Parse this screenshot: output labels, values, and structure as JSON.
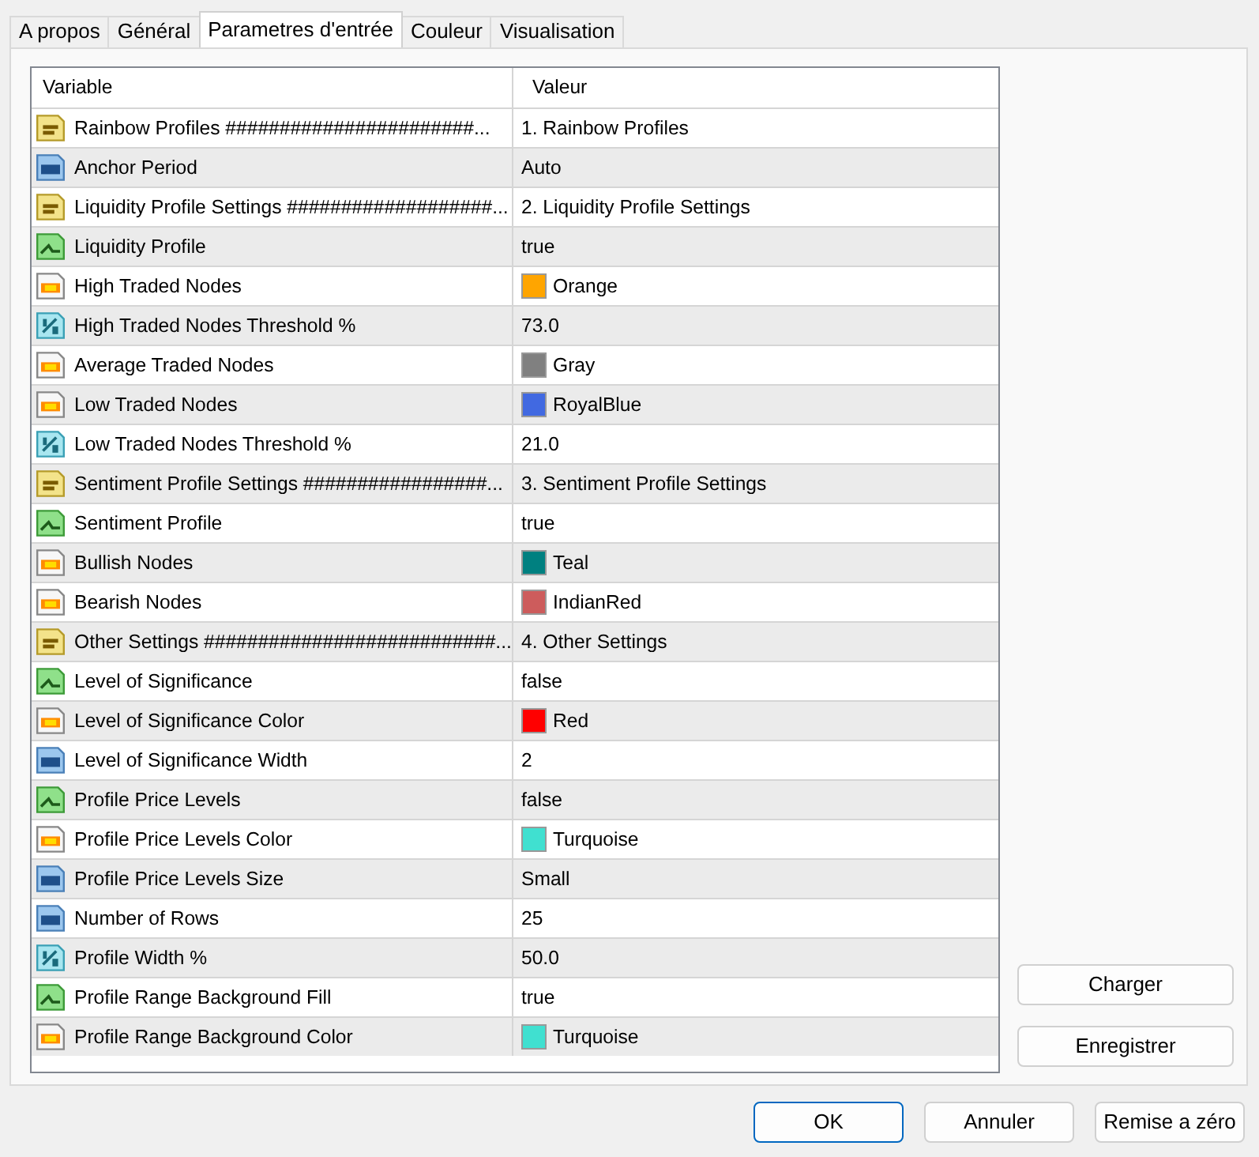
{
  "tabs": [
    {
      "label": "A propos",
      "selected": false
    },
    {
      "label": "Général",
      "selected": false
    },
    {
      "label": "Parametres d'entrée",
      "selected": true
    },
    {
      "label": "Couleur",
      "selected": false
    },
    {
      "label": "Visualisation",
      "selected": false
    }
  ],
  "table": {
    "columns": [
      "Variable",
      "Valeur"
    ],
    "rows": [
      {
        "kind": "string",
        "variable": "Rainbow Profiles #######################...",
        "value": "1. Rainbow Profiles"
      },
      {
        "kind": "int",
        "variable": "Anchor Period",
        "value": "Auto"
      },
      {
        "kind": "string",
        "variable": "Liquidity Profile Settings ###################...",
        "value": "2. Liquidity Profile Settings"
      },
      {
        "kind": "bool",
        "variable": "Liquidity Profile",
        "value": "true"
      },
      {
        "kind": "color",
        "variable": "High Traded Nodes",
        "value": "Orange",
        "color": "#ffa500"
      },
      {
        "kind": "double",
        "variable": "High Traded Nodes Threshold %",
        "value": "73.0"
      },
      {
        "kind": "color",
        "variable": "Average Traded Nodes",
        "value": "Gray",
        "color": "#808080"
      },
      {
        "kind": "color",
        "variable": "Low Traded Nodes",
        "value": "RoyalBlue",
        "color": "#4169e1"
      },
      {
        "kind": "double",
        "variable": "Low Traded Nodes Threshold %",
        "value": "21.0"
      },
      {
        "kind": "string",
        "variable": "Sentiment Profile Settings #################...",
        "value": "3. Sentiment Profile Settings"
      },
      {
        "kind": "bool",
        "variable": "Sentiment Profile",
        "value": "true"
      },
      {
        "kind": "color",
        "variable": "Bullish Nodes",
        "value": "Teal",
        "color": "#008080"
      },
      {
        "kind": "color",
        "variable": "Bearish Nodes",
        "value": "IndianRed",
        "color": "#cd5c5c"
      },
      {
        "kind": "string",
        "variable": "Other Settings ###########################...",
        "value": "4. Other Settings"
      },
      {
        "kind": "bool",
        "variable": "Level of Significance",
        "value": "false"
      },
      {
        "kind": "color",
        "variable": "Level of Significance Color",
        "value": "Red",
        "color": "#ff0000"
      },
      {
        "kind": "int",
        "variable": "Level of Significance Width",
        "value": "2"
      },
      {
        "kind": "bool",
        "variable": "Profile Price Levels",
        "value": "false"
      },
      {
        "kind": "color",
        "variable": "Profile Price Levels Color",
        "value": "Turquoise",
        "color": "#40e0d0"
      },
      {
        "kind": "int",
        "variable": "Profile Price Levels Size",
        "value": "Small"
      },
      {
        "kind": "int",
        "variable": "Number of Rows",
        "value": "25"
      },
      {
        "kind": "double",
        "variable": "Profile Width %",
        "value": "50.0"
      },
      {
        "kind": "bool",
        "variable": "Profile Range Background Fill",
        "value": "true"
      },
      {
        "kind": "color",
        "variable": "Profile Range Background Color",
        "value": "Turquoise",
        "color": "#40e0d0"
      }
    ]
  },
  "side_buttons": [
    "Charger",
    "Enregistrer"
  ],
  "buttons": [
    "OK",
    "Annuler",
    "Remise a zéro"
  ]
}
